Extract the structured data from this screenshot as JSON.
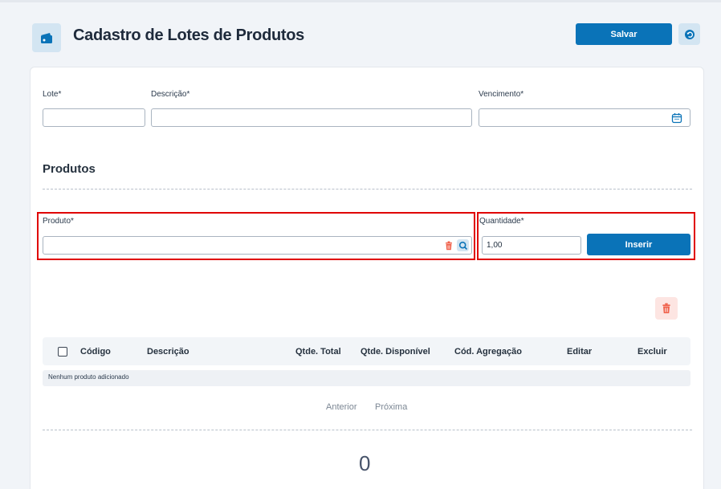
{
  "header": {
    "title": "Cadastro de Lotes de Produtos",
    "save_label": "Salvar",
    "header_icon": "wallet-icon",
    "back_icon": "undo-icon"
  },
  "form": {
    "lote_label": "Lote*",
    "lote_value": "",
    "descricao_label": "Descrição*",
    "descricao_value": "",
    "vencimento_label": "Vencimento*",
    "vencimento_value": ""
  },
  "produtos": {
    "section_title": "Produtos",
    "produto_label": "Produto*",
    "produto_value": "",
    "quantidade_label": "Quantidade*",
    "quantidade_value": "1,00",
    "insert_label": "Inserir"
  },
  "table": {
    "columns": [
      "Código",
      "Descrição",
      "Qtde. Total",
      "Qtde. Disponível",
      "Cód. Agregação",
      "Editar",
      "Excluir"
    ],
    "empty_message": "Nenhum produto adicionado"
  },
  "pagination": {
    "prev_label": "Anterior",
    "next_label": "Próxima"
  },
  "summary": {
    "total": "0"
  },
  "colors": {
    "primary": "#0a73b8",
    "danger": "#f0604a",
    "highlight_border": "#e00000"
  }
}
